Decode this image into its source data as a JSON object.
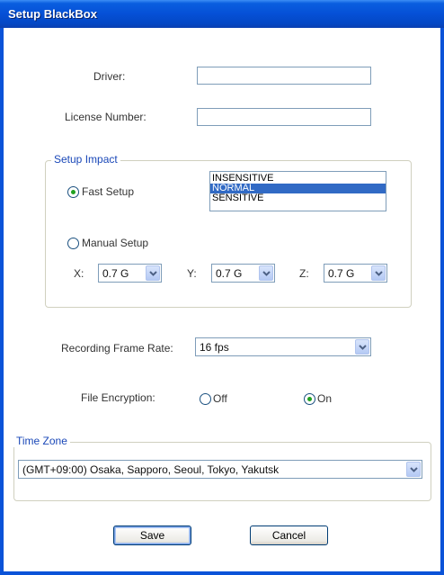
{
  "window": {
    "title": "Setup BlackBox"
  },
  "driver": {
    "label": "Driver:",
    "value": ""
  },
  "license": {
    "label": "License Number:",
    "value": ""
  },
  "setup_impact": {
    "legend": "Setup Impact",
    "fast_setup_label": "Fast Setup",
    "fast_setup_checked": true,
    "sensitivity_options": [
      "INSENSITIVE",
      "NORMAL",
      "SENSITIVE"
    ],
    "sensitivity_selected": "NORMAL",
    "manual_setup_label": "Manual Setup",
    "manual_setup_checked": false,
    "axes": [
      {
        "label": "X:",
        "value": "0.7 G"
      },
      {
        "label": "Y:",
        "value": "0.7 G"
      },
      {
        "label": "Z:",
        "value": "0.7 G"
      }
    ]
  },
  "frame_rate": {
    "label": "Recording Frame Rate:",
    "value": "16 fps"
  },
  "encryption": {
    "label": "File Encryption:",
    "off_label": "Off",
    "on_label": "On",
    "selected": "On"
  },
  "time_zone": {
    "legend": "Time Zone",
    "value": "(GMT+09:00) Osaka, Sapporo, Seoul, Tokyo, Yakutsk"
  },
  "buttons": {
    "save": "Save",
    "cancel": "Cancel"
  },
  "colors": {
    "title_bar": "#0550d6",
    "selection": "#316ac5",
    "legend_text": "#1a48b8",
    "radio_dot": "#21a121"
  }
}
